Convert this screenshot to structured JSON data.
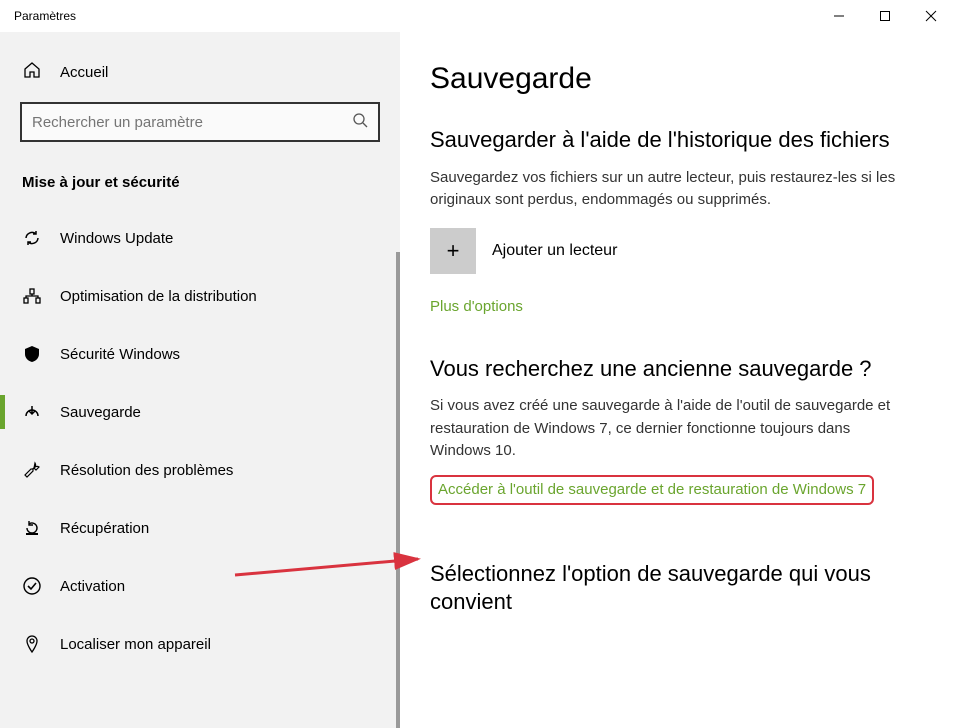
{
  "window": {
    "title": "Paramètres"
  },
  "sidebar": {
    "home": "Accueil",
    "search_placeholder": "Rechercher un paramètre",
    "section": "Mise à jour et sécurité",
    "items": [
      {
        "label": "Windows Update"
      },
      {
        "label": "Optimisation de la distribution"
      },
      {
        "label": "Sécurité Windows"
      },
      {
        "label": "Sauvegarde"
      },
      {
        "label": "Résolution des problèmes"
      },
      {
        "label": "Récupération"
      },
      {
        "label": "Activation"
      },
      {
        "label": "Localiser mon appareil"
      }
    ]
  },
  "main": {
    "title": "Sauvegarde",
    "file_history": {
      "heading": "Sauvegarder à l'aide de l'historique des fichiers",
      "desc": "Sauvegardez vos fichiers sur un autre lecteur, puis restaurez-les si les originaux sont perdus, endommagés ou supprimés.",
      "add_drive": "Ajouter un lecteur",
      "more_options": "Plus d'options"
    },
    "old_backup": {
      "heading": "Vous recherchez une ancienne sauvegarde ?",
      "desc": "Si vous avez créé une sauvegarde à l'aide de l'outil de sauvegarde et restauration de Windows 7, ce dernier fonctionne toujours dans Windows 10.",
      "link": "Accéder à l'outil de sauvegarde et de restauration de Windows 7"
    },
    "select": {
      "heading": "Sélectionnez l'option de sauvegarde qui vous convient"
    }
  }
}
